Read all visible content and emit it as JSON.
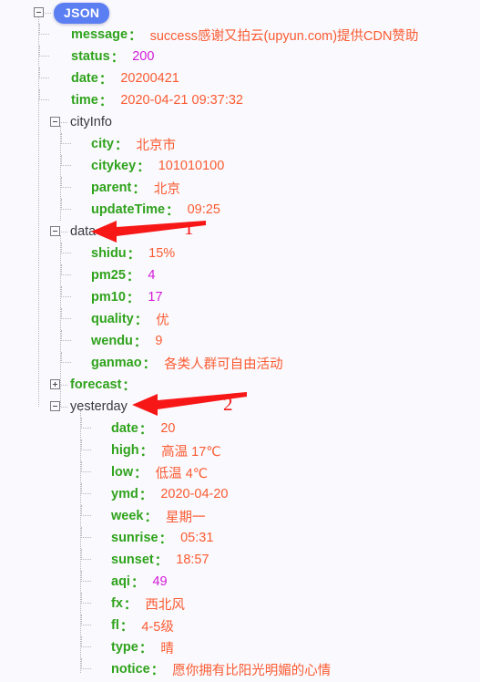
{
  "root": {
    "badge_label": "JSON",
    "toggle_state": "minus"
  },
  "colors": {
    "key": "#2fa31c",
    "string_value": "#fb5b32",
    "number_value": "#d21ad9",
    "object_name": "#3a3a40",
    "badge_bg": "#5b7ef2",
    "annotation": "#f81717",
    "background": "#faf9fd"
  },
  "tree": {
    "message": {
      "key": "message",
      "colon": "：",
      "value": "success感谢又拍云(upyun.com)提供CDN赞助",
      "type": "string"
    },
    "status": {
      "key": "status",
      "colon": "：",
      "value": "200",
      "type": "number"
    },
    "date": {
      "key": "date",
      "colon": "：",
      "value": "20200421",
      "type": "string"
    },
    "time": {
      "key": "time",
      "colon": "：",
      "value": "2020-04-21 09:37:32",
      "type": "string"
    },
    "cityInfo": {
      "name": "cityInfo",
      "toggle": "minus"
    },
    "city": {
      "key": "city",
      "colon": "：",
      "value": "北京市",
      "type": "string"
    },
    "citykey": {
      "key": "citykey",
      "colon": "：",
      "value": "101010100",
      "type": "string"
    },
    "parent": {
      "key": "parent",
      "colon": "：",
      "value": "北京",
      "type": "string"
    },
    "updateTime": {
      "key": "updateTime",
      "colon": "：",
      "value": "09:25",
      "type": "string"
    },
    "data": {
      "name": "data",
      "toggle": "minus"
    },
    "shidu": {
      "key": "shidu",
      "colon": "：",
      "value": "15%",
      "type": "string"
    },
    "pm25": {
      "key": "pm25",
      "colon": "：",
      "value": "4",
      "type": "number"
    },
    "pm10": {
      "key": "pm10",
      "colon": "：",
      "value": "17",
      "type": "number"
    },
    "quality": {
      "key": "quality",
      "colon": "：",
      "value": "优",
      "type": "string"
    },
    "wendu": {
      "key": "wendu",
      "colon": "：",
      "value": "9",
      "type": "string"
    },
    "ganmao": {
      "key": "ganmao",
      "colon": "：",
      "value": "各类人群可自由活动",
      "type": "string"
    },
    "forecast": {
      "key": "forecast",
      "colon": "：",
      "toggle": "plus"
    },
    "yesterday": {
      "name": "yesterday",
      "toggle": "minus"
    },
    "y_date": {
      "key": "date",
      "colon": "：",
      "value": "20",
      "type": "string"
    },
    "y_high": {
      "key": "high",
      "colon": "：",
      "value": "高温 17℃",
      "type": "string"
    },
    "y_low": {
      "key": "low",
      "colon": "：",
      "value": "低温 4℃",
      "type": "string"
    },
    "y_ymd": {
      "key": "ymd",
      "colon": "：",
      "value": "2020-04-20",
      "type": "string"
    },
    "y_week": {
      "key": "week",
      "colon": "：",
      "value": "星期一",
      "type": "string"
    },
    "y_sunrise": {
      "key": "sunrise",
      "colon": "：",
      "value": "05:31",
      "type": "string"
    },
    "y_sunset": {
      "key": "sunset",
      "colon": "：",
      "value": "18:57",
      "type": "string"
    },
    "y_aqi": {
      "key": "aqi",
      "colon": "：",
      "value": "49",
      "type": "number"
    },
    "y_fx": {
      "key": "fx",
      "colon": "：",
      "value": "西北风",
      "type": "string"
    },
    "y_fl": {
      "key": "fl",
      "colon": "：",
      "value": "4-5级",
      "type": "string"
    },
    "y_type": {
      "key": "type",
      "colon": "：",
      "value": "晴",
      "type": "string"
    },
    "y_notice": {
      "key": "notice",
      "colon": "：",
      "value": "愿你拥有比阳光明媚的心情",
      "type": "string"
    }
  },
  "annotations": [
    {
      "label": "1",
      "points_at": "data"
    },
    {
      "label": "2",
      "points_at": "yesterday"
    }
  ]
}
